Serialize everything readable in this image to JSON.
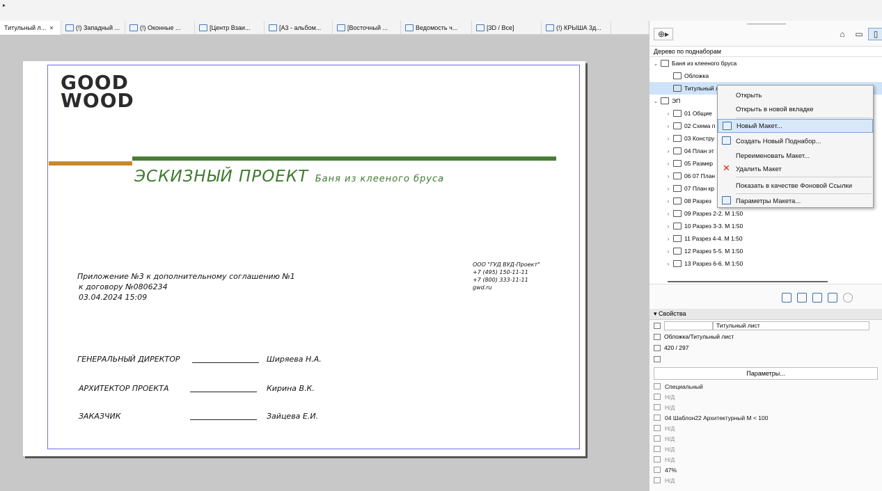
{
  "tabs": [
    {
      "label": "Титульный л...",
      "close": "×",
      "active": true
    },
    {
      "label": "(!) Западный ...",
      "active": false
    },
    {
      "label": "(!) Оконные ...",
      "active": false
    },
    {
      "label": "[Центр Взаи...",
      "active": false
    },
    {
      "label": "[А3 - альбом...",
      "active": false
    },
    {
      "label": "[Восточный ...",
      "active": false
    },
    {
      "label": "Ведомость ч...",
      "active": false
    },
    {
      "label": "[3D / Все]",
      "active": false
    },
    {
      "label": "(!) КРЫША 3д...",
      "active": false
    }
  ],
  "sheet": {
    "logo_line1": "GOOD",
    "logo_line2": "WOOD",
    "title_big": "ЭСКИЗНЫЙ ПРОЕКТ",
    "title_small": "Баня из клееного бруса",
    "appendix": "Приложение №3 к дополнительному соглашению №1",
    "contract": "к договору №0806234",
    "date": "03.04.2024 15:09",
    "company": "ООО \"ГУД ВУД-Проект\"",
    "phone1": "+7 (495) 150-11-11",
    "phone2": "+7 (800) 333-11-11",
    "site": "gwd.ru",
    "role1": "ГЕНЕРАЛЬНЫЙ ДИРЕКТОР",
    "name1": "Шиpяeва Н.А.",
    "role2": "АРХИТЕКТОР ПРОЕКТА",
    "name2": "Кирина В.К.",
    "role3": "ЗАКАЗЧИК",
    "name3": "Зайцева Е.И."
  },
  "panel": {
    "tree_title": "Дерево по поднаборам",
    "tree": [
      {
        "label": "Баня из клееного бруса",
        "indent": 0,
        "chev": "v"
      },
      {
        "label": "Обложка",
        "indent": 1,
        "chev": ""
      },
      {
        "label": "Титульный л",
        "indent": 1,
        "chev": "",
        "selected": true
      },
      {
        "label": "ЭП",
        "indent": 0,
        "chev": "v"
      },
      {
        "label": "01 Общие",
        "indent": 1,
        "chev": ">"
      },
      {
        "label": "02 Схема п",
        "indent": 1,
        "chev": ">"
      },
      {
        "label": "03 Констру",
        "indent": 1,
        "chev": ">"
      },
      {
        "label": "04 План эт",
        "indent": 1,
        "chev": ">"
      },
      {
        "label": "05 Размер",
        "indent": 1,
        "chev": ">"
      },
      {
        "label": "06 07 План",
        "indent": 1,
        "chev": ">"
      },
      {
        "label": "07 План кр",
        "indent": 1,
        "chev": ">"
      },
      {
        "label": "08 Разрез",
        "indent": 1,
        "chev": ">"
      },
      {
        "label": "09 Разрез 2-2.  М 1:50",
        "indent": 1,
        "chev": ">"
      },
      {
        "label": "10 Разрез 3-3.  М 1:50",
        "indent": 1,
        "chev": ">"
      },
      {
        "label": "11 Разрез 4-4.  М 1:50",
        "indent": 1,
        "chev": ">"
      },
      {
        "label": "12 Разрез 5-5.  М 1:50",
        "indent": 1,
        "chev": ">"
      },
      {
        "label": "13 Разрез 6-6.  М 1:50",
        "indent": 1,
        "chev": ">"
      }
    ],
    "props_title": "Свойства",
    "prop_name": "Титульный лист",
    "prop_path": "Обложка/Титульный лист",
    "prop_size": "420 / 297",
    "params_btn": "Параметры...",
    "list": [
      {
        "label": "Специальный",
        "dark": true
      },
      {
        "label": "Н/Д",
        "dark": false
      },
      {
        "label": "Н/Д",
        "dark": false
      },
      {
        "label": "04 Шаблон22 Архитектурный М < 100",
        "dark": true
      },
      {
        "label": "Н/Д",
        "dark": false
      },
      {
        "label": "Н/Д",
        "dark": false
      },
      {
        "label": "Н/Д",
        "dark": false
      },
      {
        "label": "Н/Д",
        "dark": false
      },
      {
        "label": "47%",
        "dark": true
      },
      {
        "label": "Н/Д",
        "dark": false
      }
    ]
  },
  "menu": {
    "open": "Открыть",
    "open_tab": "Открыть в новой вкладке",
    "new_layout": "Новый Макет...",
    "new_subset": "Создать Новый Поднабор...",
    "rename": "Переименовать Макет...",
    "delete": "Удалить Макет",
    "show_bg": "Показать в качестве Фоновой Ссылки",
    "params": "Параметры Макета..."
  }
}
